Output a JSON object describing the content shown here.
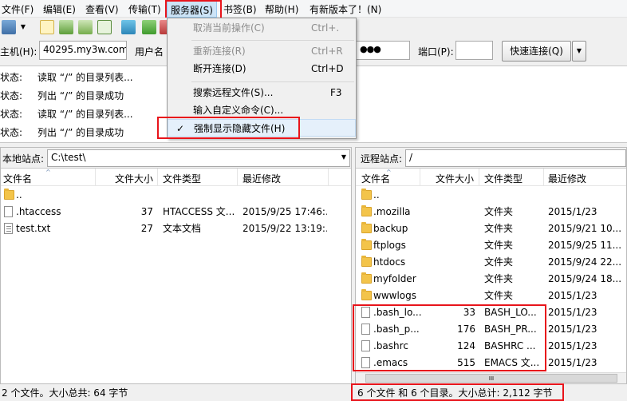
{
  "menubar": {
    "items": [
      "文件(F)",
      "编辑(E)",
      "查看(V)",
      "传输(T)",
      "服务器(S)",
      "书签(B)",
      "帮助(H)",
      "有新版本了！(N)"
    ]
  },
  "server_menu": {
    "items": [
      {
        "label": "取消当前操作(C)",
        "shortcut": "Ctrl+.",
        "disabled": true
      },
      {
        "label": "重新连接(R)",
        "shortcut": "Ctrl+R",
        "disabled": true
      },
      {
        "label": "断开连接(D)",
        "shortcut": "Ctrl+D",
        "disabled": false
      },
      {
        "label": "搜索远程文件(S)...",
        "shortcut": "F3",
        "disabled": false
      },
      {
        "label": "输入自定义命令(C)...",
        "shortcut": "",
        "disabled": false
      },
      {
        "label": "强制显示隐藏文件(H)",
        "shortcut": "",
        "disabled": false,
        "checked": true
      }
    ],
    "check_mark": "✓"
  },
  "quickconnect": {
    "host_label": "主机(H):",
    "host_value": "40295.my3w.com",
    "user_label": "用户名",
    "password_value": "●●●",
    "port_label": "端口(P):",
    "port_value": "",
    "connect_label": "快速连接(Q)",
    "dropdown_arrow": "▼"
  },
  "log": {
    "rows": [
      {
        "label": "状态:",
        "message": "读取 “/” 的目录列表..."
      },
      {
        "label": "状态:",
        "message": "列出 “/” 的目录成功"
      },
      {
        "label": "状态:",
        "message": "读取 “/” 的目录列表..."
      },
      {
        "label": "状态:",
        "message": "列出 “/” 的目录成功"
      }
    ]
  },
  "local": {
    "site_label": "本地站点:",
    "site_path": "C:\\test\\",
    "columns": {
      "name": "文件名",
      "size": "文件大小",
      "type": "文件类型",
      "modified": "最近修改"
    },
    "rows": [
      {
        "icon": "folder-icon",
        "name": "..",
        "size": "",
        "type": "",
        "modified": ""
      },
      {
        "icon": "file-icon",
        "name": ".htaccess",
        "size": "37",
        "type": "HTACCESS 文...",
        "modified": "2015/9/25 17:46:..."
      },
      {
        "icon": "text-file-icon",
        "name": "test.txt",
        "size": "27",
        "type": "文本文档",
        "modified": "2015/9/22 13:19:..."
      }
    ],
    "status": "2 个文件。大小总共: 64 字节"
  },
  "remote": {
    "site_label": "远程站点:",
    "site_path": "/",
    "columns": {
      "name": "文件名",
      "size": "文件大小",
      "type": "文件类型",
      "modified": "最近修改"
    },
    "rows": [
      {
        "icon": "folder-icon",
        "name": "..",
        "size": "",
        "type": "",
        "modified": ""
      },
      {
        "icon": "folder-icon",
        "name": ".mozilla",
        "size": "",
        "type": "文件夹",
        "modified": "2015/1/23"
      },
      {
        "icon": "folder-icon",
        "name": "backup",
        "size": "",
        "type": "文件夹",
        "modified": "2015/9/21 10..."
      },
      {
        "icon": "folder-icon",
        "name": "ftplogs",
        "size": "",
        "type": "文件夹",
        "modified": "2015/9/25 11..."
      },
      {
        "icon": "folder-icon",
        "name": "htdocs",
        "size": "",
        "type": "文件夹",
        "modified": "2015/9/24 22..."
      },
      {
        "icon": "folder-icon",
        "name": "myfolder",
        "size": "",
        "type": "文件夹",
        "modified": "2015/9/24 18..."
      },
      {
        "icon": "folder-icon",
        "name": "wwwlogs",
        "size": "",
        "type": "文件夹",
        "modified": "2015/1/23"
      },
      {
        "icon": "file-icon",
        "name": ".bash_lo...",
        "size": "33",
        "type": "BASH_LO...",
        "modified": "2015/1/23"
      },
      {
        "icon": "file-icon",
        "name": ".bash_p...",
        "size": "176",
        "type": "BASH_PR...",
        "modified": "2015/1/23"
      },
      {
        "icon": "file-icon",
        "name": ".bashrc",
        "size": "124",
        "type": "BASHRC ...",
        "modified": "2015/1/23"
      },
      {
        "icon": "file-icon",
        "name": ".emacs",
        "size": "515",
        "type": "EMACS 文...",
        "modified": "2015/1/23"
      }
    ],
    "scrollbar_grip": "III",
    "status": "6 个文件 和 6 个目录。大小总计: 2,112 字节"
  },
  "colors": {
    "highlight": "#e8141b",
    "menu_selected": "#e5f0fb"
  }
}
